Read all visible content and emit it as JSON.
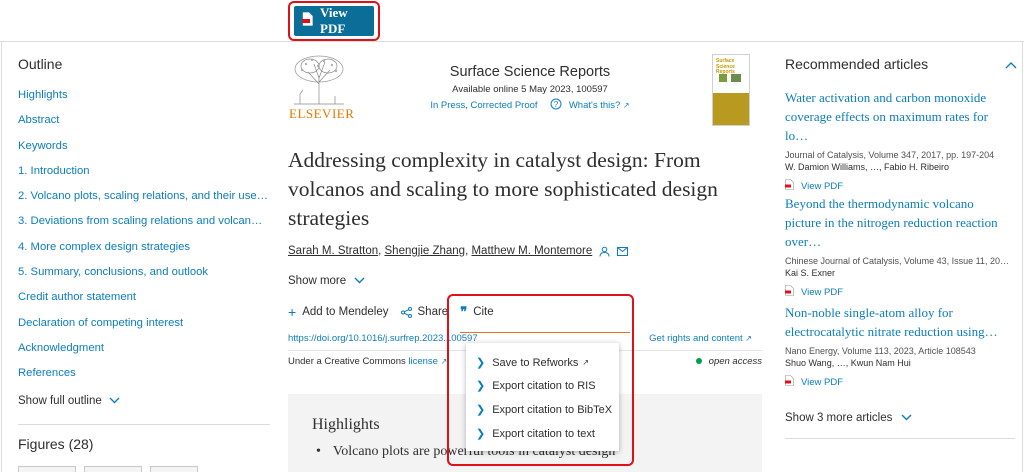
{
  "toolbar": {
    "view_pdf_label": "View PDF"
  },
  "outline": {
    "heading": "Outline",
    "items": [
      "Highlights",
      "Abstract",
      "Keywords",
      "1. Introduction",
      "2. Volcano plots, scaling relations, and their use i…",
      "3. Deviations from scaling relations and volcano p…",
      "4. More complex design strategies",
      "5. Summary, conclusions, and outlook",
      "Credit author statement",
      "Declaration of competing interest",
      "Acknowledgment",
      "References"
    ],
    "show_full": "Show full outline",
    "figures_heading": "Figures (28)"
  },
  "journal": {
    "publisher": "ELSEVIER",
    "name": "Surface Science Reports",
    "available": "Available online 5 May 2023, 100597",
    "status": "In Press, Corrected Proof",
    "whats_this": "What's this?",
    "cover_title": "Surface Science Reports"
  },
  "article": {
    "title": "Addressing complexity in catalyst design: From volcanos and scaling to more sophisticated design strategies",
    "authors": [
      "Sarah M. Stratton",
      "Shengjie Zhang",
      "Matthew M. Montemore"
    ],
    "show_more": "Show more",
    "actions": {
      "mendeley": "Add to Mendeley",
      "share": "Share",
      "cite": "Cite"
    },
    "doi": "https://doi.org/10.1016/j.surfrep.2023.100597",
    "rights": "Get rights and content",
    "cc_prefix": "Under a Creative Commons ",
    "cc_license": "license",
    "open_access": "open access",
    "highlights_heading": "Highlights",
    "highlight_1": "Volcano plots are powerful tools in catalyst design"
  },
  "cite_menu": {
    "items": [
      "Save to Refworks",
      "Export citation to RIS",
      "Export citation to BibTeX",
      "Export citation to text"
    ]
  },
  "recommended": {
    "heading": "Recommended articles",
    "articles": [
      {
        "title": "Water activation and carbon monoxide coverage effects on maximum rates for lo…",
        "meta": "Journal of Catalysis, Volume 347, 2017, pp. 197-204",
        "authors": "W. Damion Williams, …, Fabio H. Ribeiro",
        "view_pdf": "View PDF"
      },
      {
        "title": "Beyond the thermodynamic volcano picture in the nitrogen reduction reaction over…",
        "meta": "Chinese Journal of Catalysis, Volume 43, Issue 11, 202…",
        "authors": "Kai S. Exner",
        "view_pdf": "View PDF"
      },
      {
        "title": "Non-noble single-atom alloy for electrocatalytic nitrate reduction using…",
        "meta": "Nano Energy, Volume 113, 2023, Article 108543",
        "authors": "Shuo Wang, …, Kwun Nam Hui",
        "view_pdf": "View PDF"
      }
    ],
    "show_more": "Show 3 more articles"
  },
  "colors": {
    "accent": "#0c7dbb",
    "pdf_button": "#0a6e99",
    "highlight_red": "#e0101b",
    "elsevier_orange": "#ea7600",
    "open_access_green": "#00a046"
  }
}
